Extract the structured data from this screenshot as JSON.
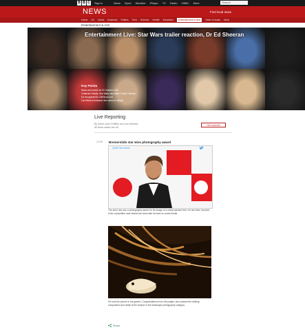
{
  "masthead": {
    "logo_letters": [
      "B",
      "B",
      "C"
    ],
    "signin": "Sign in",
    "nav": [
      "News",
      "Sport",
      "Weather",
      "iPlayer",
      "TV",
      "Radio",
      "CBBC",
      "More"
    ],
    "search_placeholder": "Search"
  },
  "header": {
    "title": "NEWS",
    "local_news": "Find local news",
    "subnav": [
      "Home",
      "UK",
      "World",
      "Business",
      "Politics",
      "Tech",
      "Science",
      "Health",
      "Education",
      "Entertainment & Arts",
      "Video & Audio",
      "More"
    ],
    "active_subnav_index": 9
  },
  "section_crumb": "Entertainment & Arts",
  "hero": {
    "title": "Entertainment Live: Star Wars trailer reaction, Dr Ed Sheeran",
    "key_points_title": "Key Points",
    "key_points": [
      "Music and events for 20 October 2015",
      "Celebrate Strictly: Star Wars new trailer, Dustin Hoffman",
      "Ed recognised for Cliff Bono sort",
      "Cat Wilson's husband: Ann news for details"
    ]
  },
  "live": {
    "heading": "Live Reporting",
    "byline_lines": [
      "By Sarah Jane Griffiths and Lizo Mzimba",
      "All times stated are UK"
    ],
    "get_involved": "Get involved"
  },
  "post": {
    "time": "12:48",
    "title": "Bremerstide star wins photography award",
    "tweet_handle": "@BBCBreakfast",
    "text": "The actor has won a photography award for his image of a newly hatched bird. He has been involved in the competition and shared the news with his fans on social media.",
    "after_text": "He took the picture in his garden. Congratulations from the judges, who praised the striking composition and detail of the subject in the landscape photography category.",
    "share_label": "Share"
  },
  "colors": {
    "brand_red": "#bb1919",
    "subnav_red": "#a81717",
    "twitter_blue": "#55acee",
    "share_green": "#2a8a4a"
  }
}
